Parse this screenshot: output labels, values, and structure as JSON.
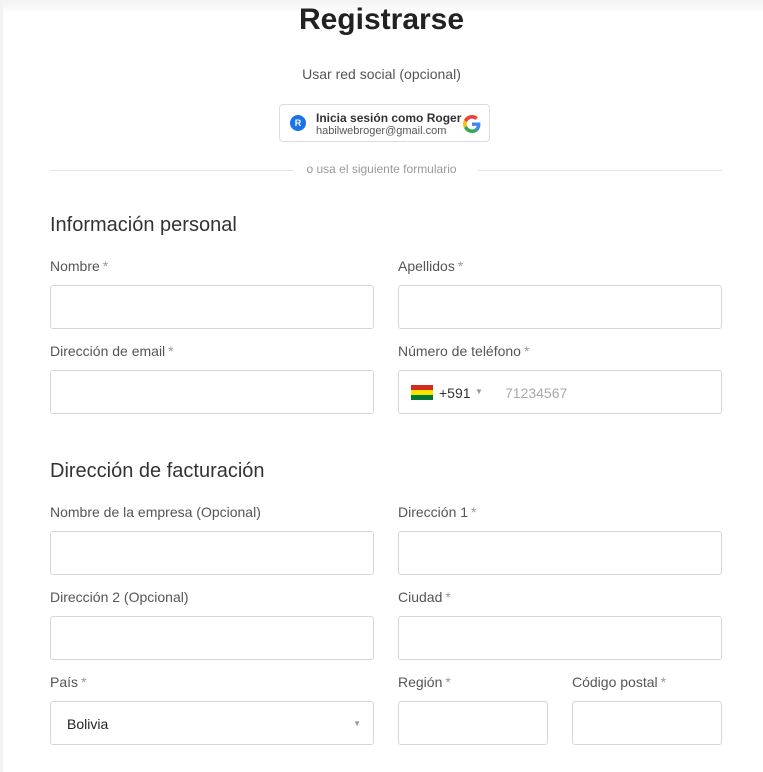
{
  "page": {
    "title": "Registrarse",
    "social_label": "Usar red social (opcional)",
    "divider_text": "o usa el siguiente formulario"
  },
  "google_button": {
    "name": "Inicia sesión como Roger",
    "email": "habilwebroger@gmail.com",
    "avatar_icon": "user-avatar-icon",
    "logo_icon": "google-logo-icon"
  },
  "personal": {
    "title": "Información personal",
    "nombre_label": "Nombre",
    "apellidos_label": "Apellidos",
    "email_label": "Dirección de email",
    "phone_label": "Número de teléfono",
    "phone_code": "+591",
    "phone_placeholder": "71234567",
    "required_mark": "*"
  },
  "billing": {
    "title": "Dirección de facturación",
    "empresa_label": "Nombre de la empresa (Opcional)",
    "direccion1_label": "Dirección 1",
    "direccion2_label": "Dirección 2 (Opcional)",
    "ciudad_label": "Ciudad",
    "pais_label": "País",
    "pais_value": "Bolivia",
    "region_label": "Región",
    "postal_label": "Código postal",
    "required_mark": "*"
  },
  "colors": {
    "border": "#d7d7d7",
    "google_blue": "#4285F4",
    "google_red": "#EA4335",
    "google_yellow": "#FBBC05",
    "google_green": "#34A853"
  }
}
